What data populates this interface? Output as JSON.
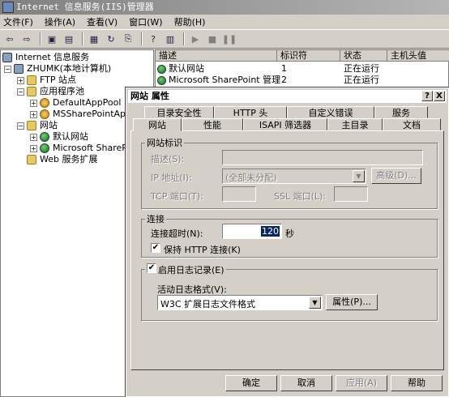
{
  "window": {
    "title": "Internet 信息服务(IIS)管理器"
  },
  "menu": [
    "文件(F)",
    "操作(A)",
    "查看(V)",
    "窗口(W)",
    "帮助(H)"
  ],
  "tree": {
    "root": "Internet 信息服务",
    "computer": "ZHUMK(本地计算机)",
    "ftp": "FTP 站点",
    "apppools": "应用程序池",
    "pool1": "DefaultAppPool",
    "pool2": "MSSharePointAppPo",
    "websites": "网站",
    "site1": "默认网站",
    "site2": "Microsoft SharePo",
    "ext": "Web 服务扩展"
  },
  "list": {
    "headers": [
      "描述",
      "标识符",
      "状态",
      "主机头值"
    ],
    "rows": [
      [
        "默认网站",
        "1",
        "正在运行",
        ""
      ],
      [
        "Microsoft SharePoint 管理",
        "2",
        "正在运行",
        ""
      ]
    ]
  },
  "dialog": {
    "title": "网站 属性",
    "help_btn": "?",
    "close_btn": "X",
    "tabs_back": [
      "目录安全性",
      "HTTP 头",
      "自定义错误",
      "服务"
    ],
    "tabs_front": [
      "网站",
      "性能",
      "ISAPI 筛选器",
      "主目录",
      "文档"
    ],
    "site_id": {
      "legend": "网站标识",
      "desc_label": "描述(S):",
      "ip_label": "IP 地址(I):",
      "ip_value": "(全部未分配)",
      "advanced": "高级(D)...",
      "tcp_label": "TCP 端口(T):",
      "ssl_label": "SSL 端口(L):"
    },
    "connection": {
      "legend": "连接",
      "timeout_label": "连接超时(N):",
      "timeout_value": "120",
      "timeout_unit": "秒",
      "keepalive": "保持 HTTP 连接(K)"
    },
    "logging": {
      "legend": "启用日志记录(E)",
      "format_label": "活动日志格式(V):",
      "format_value": "W3C 扩展日志文件格式",
      "props": "属性(P)..."
    },
    "buttons": {
      "ok": "确定",
      "cancel": "取消",
      "apply": "应用(A)",
      "help": "帮助"
    }
  }
}
